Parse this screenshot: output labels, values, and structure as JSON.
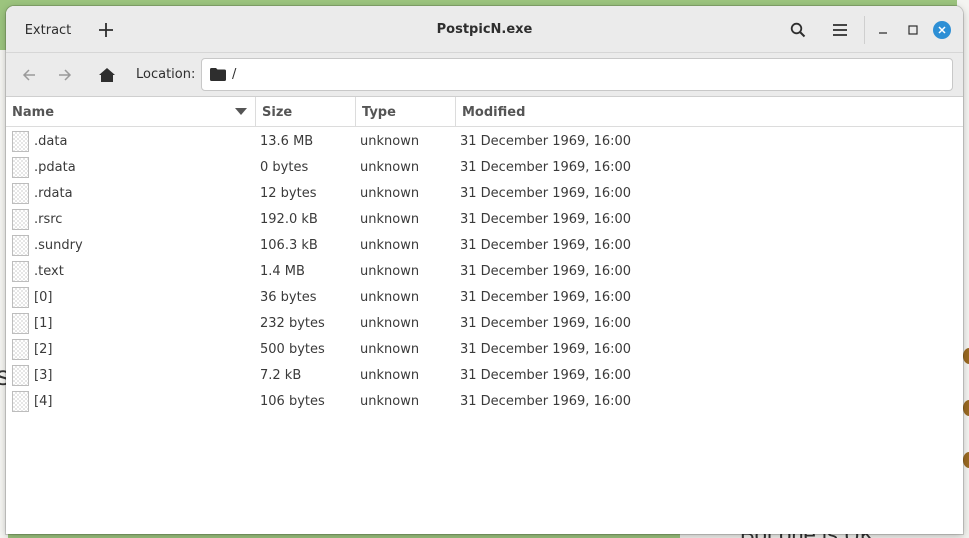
{
  "window": {
    "title": "PostpicN.exe",
    "extract_label": "Extract",
    "add_icon": "plus-icon",
    "search_icon": "search-icon",
    "menu_icon": "hamburger-menu-icon",
    "minimize_icon": "minimize-icon",
    "maximize_icon": "maximize-icon",
    "close_icon": "close-icon",
    "close_color": "#2d8fd5"
  },
  "toolbar": {
    "back_icon": "arrow-left-icon",
    "forward_icon": "arrow-right-icon",
    "home_icon": "home-icon",
    "location_label": "Location:",
    "location_value": "/",
    "folder_icon": "folder-icon"
  },
  "columns": {
    "name": "Name",
    "size": "Size",
    "type": "Type",
    "modified": "Modified",
    "sort_icon": "sort-descending-icon"
  },
  "files": [
    {
      "name": ".data",
      "size": "13.6 MB",
      "type": "unknown",
      "modified": "31 December 1969, 16:00"
    },
    {
      "name": ".pdata",
      "size": "0 bytes",
      "type": "unknown",
      "modified": "31 December 1969, 16:00"
    },
    {
      "name": ".rdata",
      "size": "12 bytes",
      "type": "unknown",
      "modified": "31 December 1969, 16:00"
    },
    {
      "name": ".rsrc",
      "size": "192.0 kB",
      "type": "unknown",
      "modified": "31 December 1969, 16:00"
    },
    {
      "name": ".sundry",
      "size": "106.3 kB",
      "type": "unknown",
      "modified": "31 December 1969, 16:00"
    },
    {
      "name": ".text",
      "size": "1.4 MB",
      "type": "unknown",
      "modified": "31 December 1969, 16:00"
    },
    {
      "name": "[0]",
      "size": "36 bytes",
      "type": "unknown",
      "modified": "31 December 1969, 16:00"
    },
    {
      "name": "[1]",
      "size": "232 bytes",
      "type": "unknown",
      "modified": "31 December 1969, 16:00"
    },
    {
      "name": "[2]",
      "size": "500 bytes",
      "type": "unknown",
      "modified": "31 December 1969, 16:00"
    },
    {
      "name": "[3]",
      "size": "7.2 kB",
      "type": "unknown",
      "modified": "31 December 1969, 16:00"
    },
    {
      "name": "[4]",
      "size": "106 bytes",
      "type": "unknown",
      "modified": "31 December 1969, 16:00"
    }
  ],
  "background": {
    "left_text": "s",
    "bottom_text": "Bot one is UK"
  }
}
